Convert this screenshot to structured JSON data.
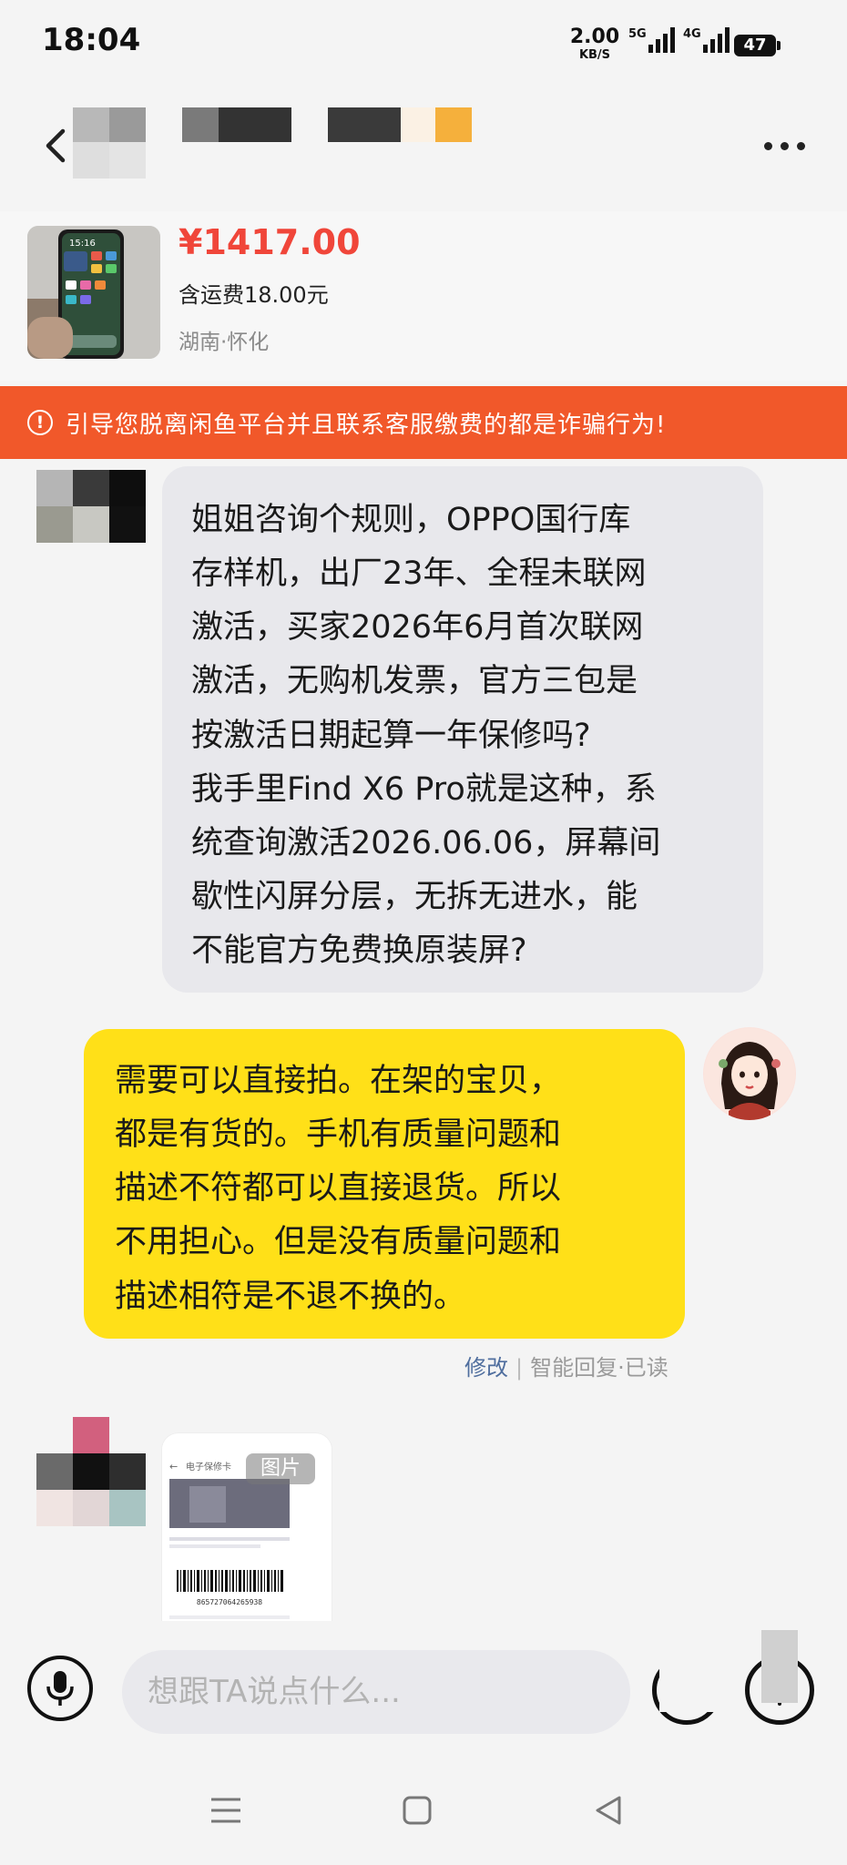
{
  "status_bar": {
    "time": "18:04",
    "net_speed_value": "2.00",
    "net_speed_unit": "KB/S",
    "sim1_label": "5G",
    "sim2_label": "4G",
    "battery": "47"
  },
  "header": {
    "back_icon": "chevron-left-icon",
    "more_icon": "more-horizontal-icon"
  },
  "product": {
    "price": "¥1417.00",
    "shipping": "含运费18.00元",
    "location": "湖南·怀化",
    "thumb_time": "15:16"
  },
  "warning": {
    "text": "引导您脱离闲鱼平台并且联系客服缴费的都是诈骗行为!",
    "color": "#f1582a"
  },
  "messages": {
    "msg1_lines": [
      "姐姐咨询个规则，OPPO国行库",
      "存样机，出厂23年、全程未联网",
      "激活，买家2026年6月首次联网",
      "激活，无购机发票，官方三包是",
      "按激活日期起算一年保修吗?",
      "我手里Find X6 Pro就是这种，系",
      "统查询激活2026.06.06，屏幕间",
      "歇性闪屏分层，无拆无进水，能",
      "不能官方免费换原装屏?"
    ],
    "msg2_lines": [
      "需要可以直接拍。在架的宝贝，",
      "都是有货的。手机有质量问题和",
      "描述不符都可以直接退货。所以",
      "不用担心。但是没有质量问题和",
      "描述相符是不退不换的。"
    ],
    "msg2_status": {
      "edit": "修改",
      "separator": "|",
      "reply_status": "智能回复·已读"
    },
    "image_message": {
      "badge": "图片",
      "card_title": "电子保修卡",
      "barcode_number": "865727064265938"
    }
  },
  "input_bar": {
    "placeholder": "想跟TA说点什么...",
    "mic_icon": "microphone-icon"
  },
  "colors": {
    "price": "#f0463a",
    "my_bubble": "#ffe018",
    "their_bubble": "#e8e8ec"
  }
}
